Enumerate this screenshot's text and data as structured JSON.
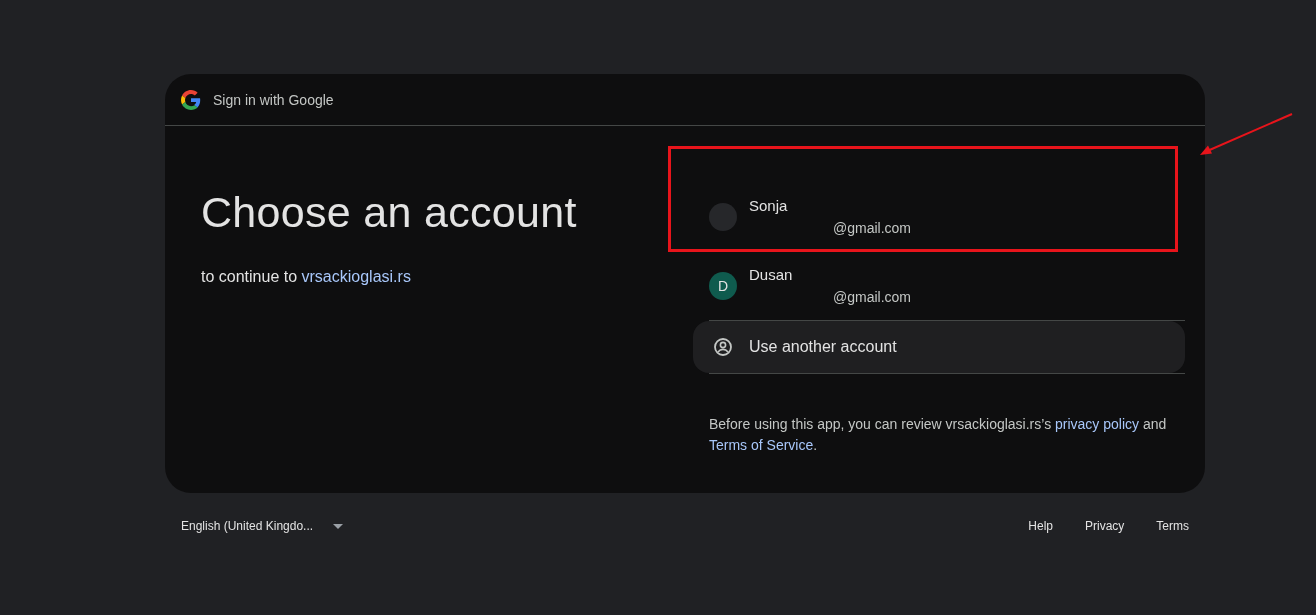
{
  "header": {
    "title": "Sign in with Google"
  },
  "heading": "Choose an account",
  "subtitle": {
    "text": "to continue to",
    "link": "vrsackioglasi.rs"
  },
  "accounts": [
    {
      "name": "Sonja",
      "email": "@gmail.com",
      "color": "#26272a"
    },
    {
      "name": "Dusan",
      "email": "@gmail.com",
      "initial": "D",
      "color": "#0f5b4e"
    }
  ],
  "other_account": "Use another account",
  "notice": {
    "text": "Before using this app, you can review vrsackioglasi.rs’s",
    "privacy_link": "privacy policy",
    "joiner": "and",
    "terms_link": "Terms of Service",
    "end": "."
  },
  "footer": {
    "language": "English (United Kingdo...",
    "links": [
      "Help",
      "Privacy",
      "Terms"
    ]
  },
  "annotation_box": true,
  "annotation_arrow": true
}
